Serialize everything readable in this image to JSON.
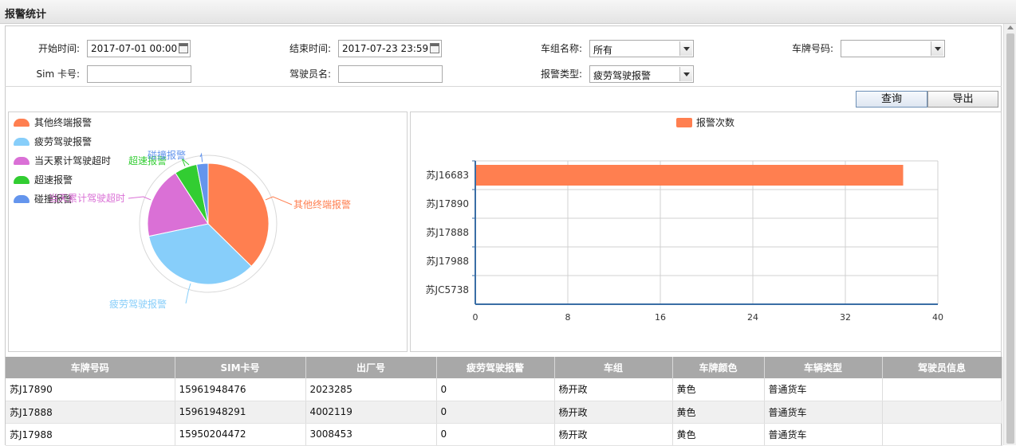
{
  "title": "报警统计",
  "filters": {
    "start_label": "开始时间:",
    "start_value": "2017-07-01 00:00",
    "end_label": "结束时间:",
    "end_value": "2017-07-23 23:59",
    "group_label": "车组名称:",
    "group_value": "所有",
    "plate_label": "车牌号码:",
    "plate_value": "",
    "sim_label": "Sim 卡号:",
    "sim_value": "",
    "driver_label": "驾驶员名:",
    "driver_value": "",
    "alarm_type_label": "报警类型:",
    "alarm_type_value": "疲劳驾驶报警"
  },
  "actions": {
    "query": "查询",
    "export": "导出"
  },
  "pie_legend": [
    {
      "label": "其他终端报警",
      "color": "#ff7f50"
    },
    {
      "label": "疲劳驾驶报警",
      "color": "#87cefa"
    },
    {
      "label": "当天累计驾驶超时",
      "color": "#da70d6"
    },
    {
      "label": "超速报警",
      "color": "#32cd32"
    },
    {
      "label": "碰撞报警",
      "color": "#6495ed"
    }
  ],
  "pie_labels": {
    "s0": "其他终端报警",
    "s1": "疲劳驾驶报警",
    "s2": "当天累计驾驶超时",
    "s3": "超速报警",
    "s4": "碰撞报警"
  },
  "chart_data": [
    {
      "type": "pie",
      "slices": [
        {
          "name": "其他终端报警",
          "value": 37,
          "color": "#ff7f50"
        },
        {
          "name": "疲劳驾驶报警",
          "value": 34,
          "color": "#87cefa"
        },
        {
          "name": "当天累计驾驶超时",
          "value": 19,
          "color": "#da70d6"
        },
        {
          "name": "超速报警",
          "value": 6,
          "color": "#32cd32"
        },
        {
          "name": "碰撞报警",
          "value": 3,
          "color": "#6495ed"
        }
      ],
      "legend_position": "top-left"
    },
    {
      "type": "bar",
      "orientation": "horizontal",
      "legend": "报警次数",
      "legend_color": "#ff7f50",
      "categories": [
        "苏J16683",
        "苏J17890",
        "苏J17888",
        "苏J17988",
        "苏JC5738"
      ],
      "values": [
        37,
        0,
        0,
        0,
        0
      ],
      "x_ticks": [
        "0",
        "8",
        "16",
        "24",
        "32",
        "40"
      ],
      "xlim": [
        0,
        40
      ],
      "grid": true
    }
  ],
  "table": {
    "headers": [
      "车牌号码",
      "SIM卡号",
      "出厂号",
      "疲劳驾驶报警",
      "车组",
      "车牌颜色",
      "车辆类型",
      "驾驶员信息"
    ],
    "rows": [
      [
        "苏J17890",
        "15961948476",
        "2023285",
        "0",
        "杨开政",
        "黄色",
        "普通货车",
        ""
      ],
      [
        "苏J17888",
        "15961948291",
        "4002119",
        "0",
        "杨开政",
        "黄色",
        "普通货车",
        ""
      ],
      [
        "苏J17988",
        "15950204472",
        "3008453",
        "0",
        "杨开政",
        "黄色",
        "普通货车",
        ""
      ]
    ]
  }
}
